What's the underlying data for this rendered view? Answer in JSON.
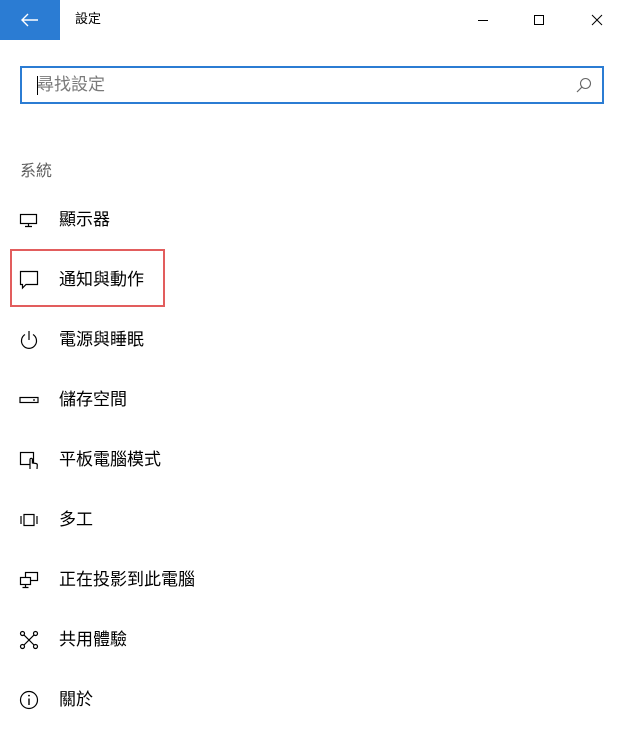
{
  "window": {
    "title": "設定",
    "accent_color": "#2b7cd3",
    "controls": [
      "minimize-icon",
      "maximize-icon",
      "close-icon"
    ]
  },
  "search": {
    "placeholder": "尋找設定",
    "value": ""
  },
  "section": {
    "title": "系統"
  },
  "nav": {
    "items": [
      {
        "label": "顯示器",
        "icon": "display-icon"
      },
      {
        "label": "通知與動作",
        "icon": "notification-icon",
        "highlighted": true
      },
      {
        "label": "電源與睡眠",
        "icon": "power-icon"
      },
      {
        "label": "儲存空間",
        "icon": "storage-icon"
      },
      {
        "label": "平板電腦模式",
        "icon": "tablet-mode-icon"
      },
      {
        "label": "多工",
        "icon": "multitasking-icon"
      },
      {
        "label": "正在投影到此電腦",
        "icon": "projecting-icon"
      },
      {
        "label": "共用體驗",
        "icon": "shared-experiences-icon"
      },
      {
        "label": "關於",
        "icon": "about-icon"
      }
    ]
  },
  "highlight_color": "#e25d5d"
}
